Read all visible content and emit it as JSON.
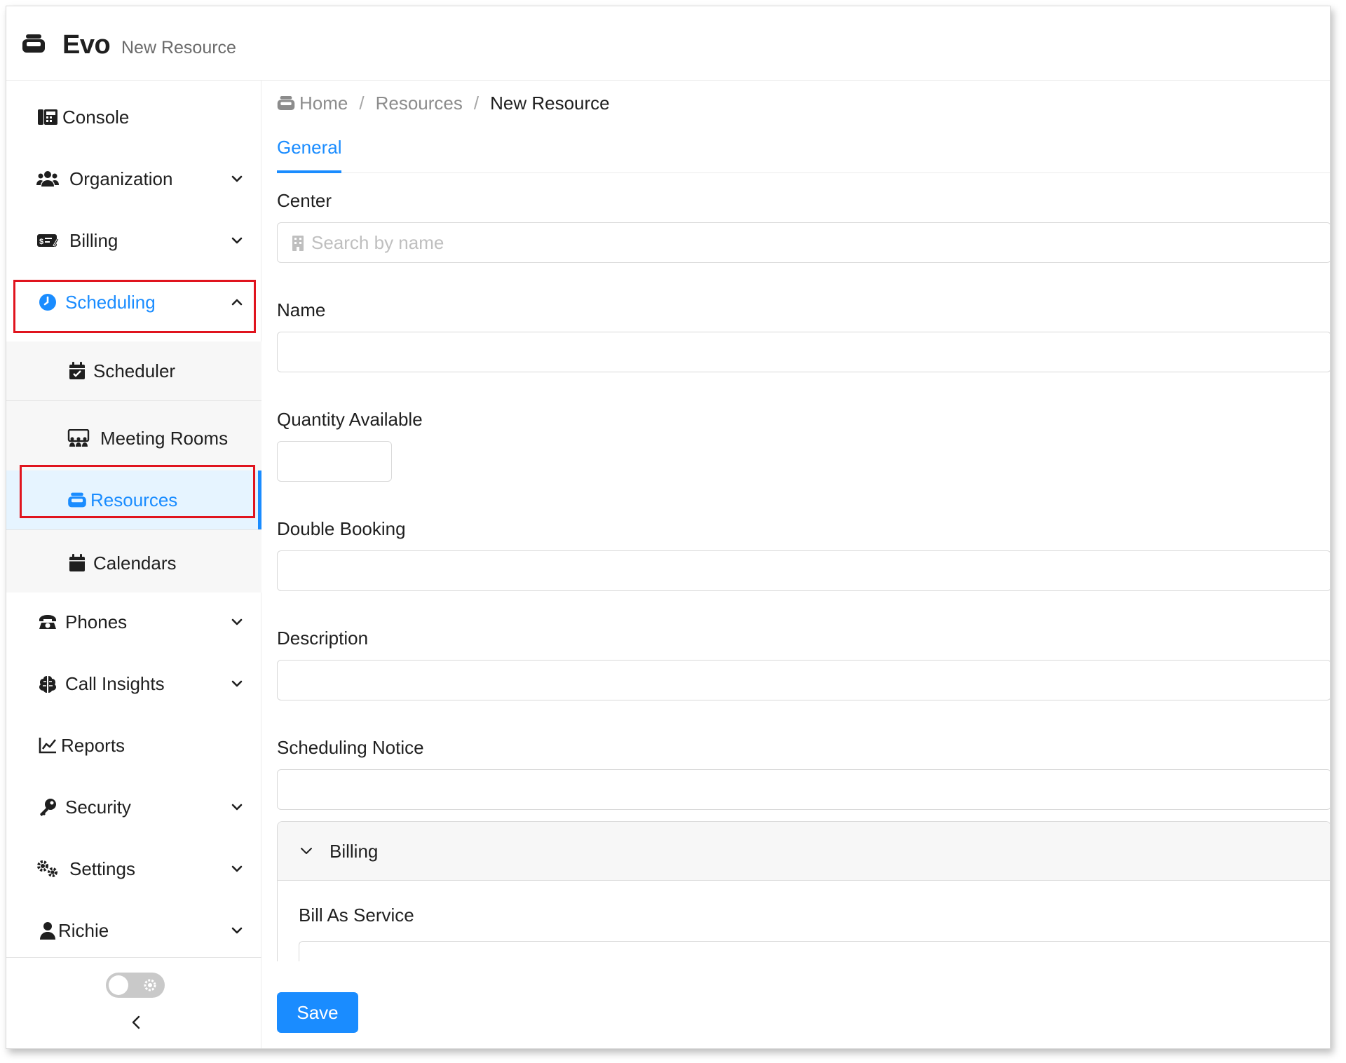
{
  "app": {
    "name": "Evo",
    "subtitle": "New Resource"
  },
  "sidebar": {
    "items": [
      {
        "label": "Console",
        "icon": "console-icon",
        "expandable": false
      },
      {
        "label": "Organization",
        "icon": "users-icon",
        "expandable": true
      },
      {
        "label": "Billing",
        "icon": "billing-icon",
        "expandable": true
      },
      {
        "label": "Scheduling",
        "icon": "clock-icon",
        "expandable": true,
        "expanded": true,
        "active": true
      },
      {
        "label": "Phones",
        "icon": "phone-icon",
        "expandable": true
      },
      {
        "label": "Call Insights",
        "icon": "brain-icon",
        "expandable": true
      },
      {
        "label": "Reports",
        "icon": "chart-line-icon",
        "expandable": false
      },
      {
        "label": "Security",
        "icon": "key-icon",
        "expandable": true
      },
      {
        "label": "Settings",
        "icon": "gears-icon",
        "expandable": true
      },
      {
        "label": "Richie",
        "icon": "user-icon",
        "expandable": true
      }
    ],
    "scheduling_children": [
      {
        "label": "Scheduler",
        "icon": "calendar-check-icon"
      },
      {
        "label": "Meeting Rooms",
        "icon": "meeting-room-icon"
      },
      {
        "label": "Resources",
        "icon": "resource-icon",
        "selected": true
      },
      {
        "label": "Calendars",
        "icon": "calendar-icon"
      }
    ],
    "collapse_label": "<"
  },
  "breadcrumb": {
    "home": "Home",
    "section": "Resources",
    "current": "New Resource",
    "separator": "/"
  },
  "tabs": [
    {
      "label": "General",
      "active": true
    }
  ],
  "form": {
    "center": {
      "label": "Center",
      "placeholder": "Search by name",
      "value": ""
    },
    "name": {
      "label": "Name",
      "value": ""
    },
    "quantity": {
      "label": "Quantity Available",
      "value": ""
    },
    "double_booking": {
      "label": "Double Booking",
      "value": ""
    },
    "description": {
      "label": "Description",
      "value": ""
    },
    "scheduling_notice": {
      "label": "Scheduling Notice",
      "value": ""
    },
    "billing_panel": {
      "title": "Billing",
      "bill_as_service_label": "Bill As Service"
    },
    "save_label": "Save"
  },
  "colors": {
    "accent": "#1a8cff",
    "highlight": "#e0141e",
    "selected_bg": "#e6f4ff"
  }
}
